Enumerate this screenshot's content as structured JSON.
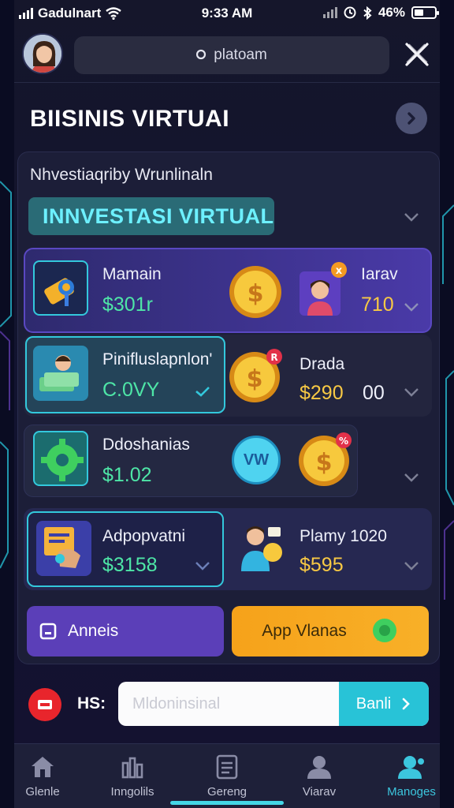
{
  "status_bar": {
    "carrier": "Gadulnart",
    "time": "9:33 AM",
    "battery": "46%",
    "battery_level": 0.46
  },
  "header": {
    "search_text": "platoam"
  },
  "page": {
    "title": "BIISINIS VIRTUAI",
    "subtitle": "Nhvestiaqriby Wrunlinaln",
    "tag": "INNVESTASI VIRTUAL"
  },
  "rows": [
    {
      "label": "Mamain",
      "value": "$301r",
      "right_label": "Iarav",
      "right_value": "710"
    },
    {
      "label": "Pinifluslapnlon'",
      "value": "C.0VY",
      "right_label": "Drada",
      "right_value": "$290",
      "right_extra": "00"
    },
    {
      "label": "Ddoshanias",
      "value": "$1.02",
      "badge": "VW"
    },
    {
      "label": "Adpopvatni",
      "value": "$3158",
      "right_label": "Plamy 1020",
      "right_value": "$595"
    }
  ],
  "actions": {
    "left_button": "Anneis",
    "right_button": "App Vlanas"
  },
  "bottom": {
    "hs_label": "HS:",
    "input_placeholder": "Mldoninsinal",
    "input_button": "Banli"
  },
  "tabs": [
    {
      "label": "Glenle",
      "icon": "home-icon"
    },
    {
      "label": "Inngolils",
      "icon": "chart-icon"
    },
    {
      "label": "Gereng",
      "icon": "document-icon"
    },
    {
      "label": "Viarav",
      "icon": "user-icon"
    },
    {
      "label": "Manoges",
      "icon": "users-icon"
    }
  ],
  "colors": {
    "accent_cyan": "#33c8dc",
    "accent_purple": "#5c3fb4",
    "accent_orange": "#f6a21a",
    "value_green": "#4ee6a7",
    "value_yellow": "#f8c944"
  }
}
